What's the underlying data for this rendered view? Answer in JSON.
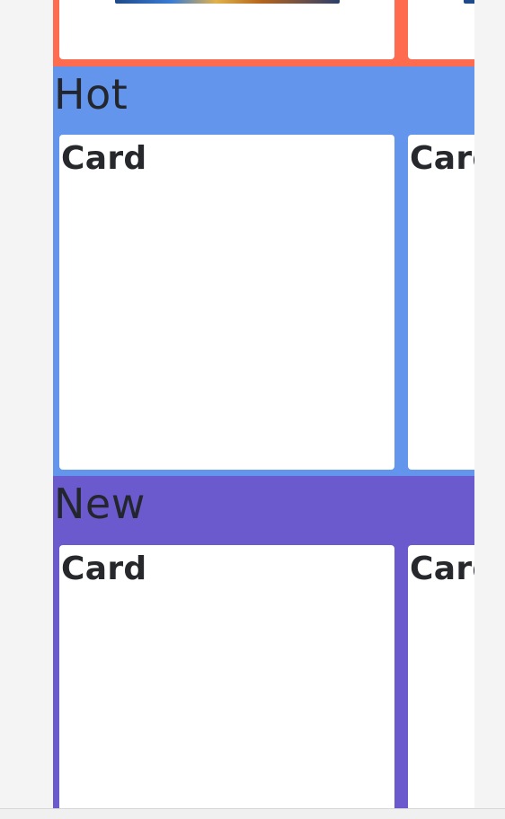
{
  "colors": {
    "page_background": "#f4f4f4",
    "section_top": "#ff6b4f",
    "section_hot": "#6495ed",
    "section_new": "#6a5acd",
    "card_background": "#ffffff",
    "title_text": "#23262c",
    "card_image_gradient": [
      "#1f4a8a",
      "#3a7bd5",
      "#e0b24a",
      "#b5651d",
      "#2c3e6b"
    ]
  },
  "sections": [
    {
      "id": "top",
      "title": "",
      "cards": [
        {
          "title": "",
          "has_image": true
        },
        {
          "title": "",
          "has_image": true
        }
      ]
    },
    {
      "id": "hot",
      "title": "Hot",
      "cards": [
        {
          "title": "Card"
        },
        {
          "title": "Card"
        }
      ]
    },
    {
      "id": "new",
      "title": "New",
      "cards": [
        {
          "title": "Card"
        },
        {
          "title": "Card"
        }
      ]
    }
  ]
}
